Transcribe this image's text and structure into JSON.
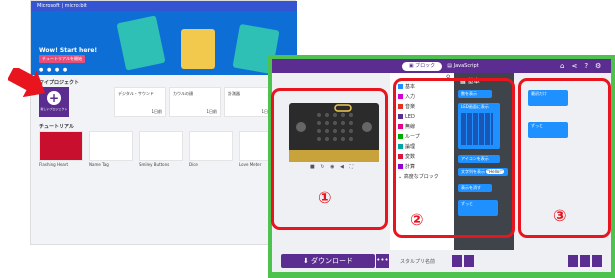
{
  "home": {
    "brand": "Microsoft | micro:bit",
    "hero_title": "Wow! Start here!",
    "hero_button": "チュートリアルを開始",
    "my_projects_heading": "マイプロジェクト",
    "new_project_label": "新しいプロジェクト",
    "project_cards": [
      {
        "title": "デジタル・サウンド",
        "meta": "1日前"
      },
      {
        "title": "カウルの顔",
        "meta": "1日前"
      },
      {
        "title": "計測器",
        "meta": "1日前"
      }
    ],
    "tutorials_heading": "チュートリアル",
    "tutorials": [
      "Flashing Heart",
      "Name Tag",
      "Smiley Buttons",
      "Dice",
      "Love Meter"
    ]
  },
  "editor": {
    "tab_blocks": "ブロック",
    "tab_js": "JavaScript",
    "toolbox_categories": [
      {
        "label": "基本",
        "color": "#1e90ff"
      },
      {
        "label": "入力",
        "color": "#d400d4"
      },
      {
        "label": "音楽",
        "color": "#e63022"
      },
      {
        "label": "LED",
        "color": "#5c2d91"
      },
      {
        "label": "無線",
        "color": "#e3008c"
      },
      {
        "label": "ループ",
        "color": "#00aa00"
      },
      {
        "label": "論理",
        "color": "#00a4a6"
      },
      {
        "label": "変数",
        "color": "#dc143c"
      },
      {
        "label": "計算",
        "color": "#9400d3"
      },
      {
        "label": "高度なブロック",
        "color": "#333333"
      }
    ],
    "flyout_title": "基本",
    "flyout_blocks": [
      "数を表示",
      "LED画面に表示",
      "アイコンを表示",
      "文字列を表示",
      "表示を消す",
      "ずっと"
    ],
    "flyout_string": "\"Hello!\"",
    "workspace_blocks": [
      "最初だけ",
      "ずっと"
    ],
    "download_label": "ダウンロード",
    "download_more": "•••",
    "project_name_label": "スタルプリ名前"
  },
  "annotations": {
    "area1": "①",
    "area2": "②",
    "area3": "③",
    "highlight_color": "#e8141e",
    "arrow_color": "#e8141e",
    "frame_color": "#4ec24e"
  }
}
